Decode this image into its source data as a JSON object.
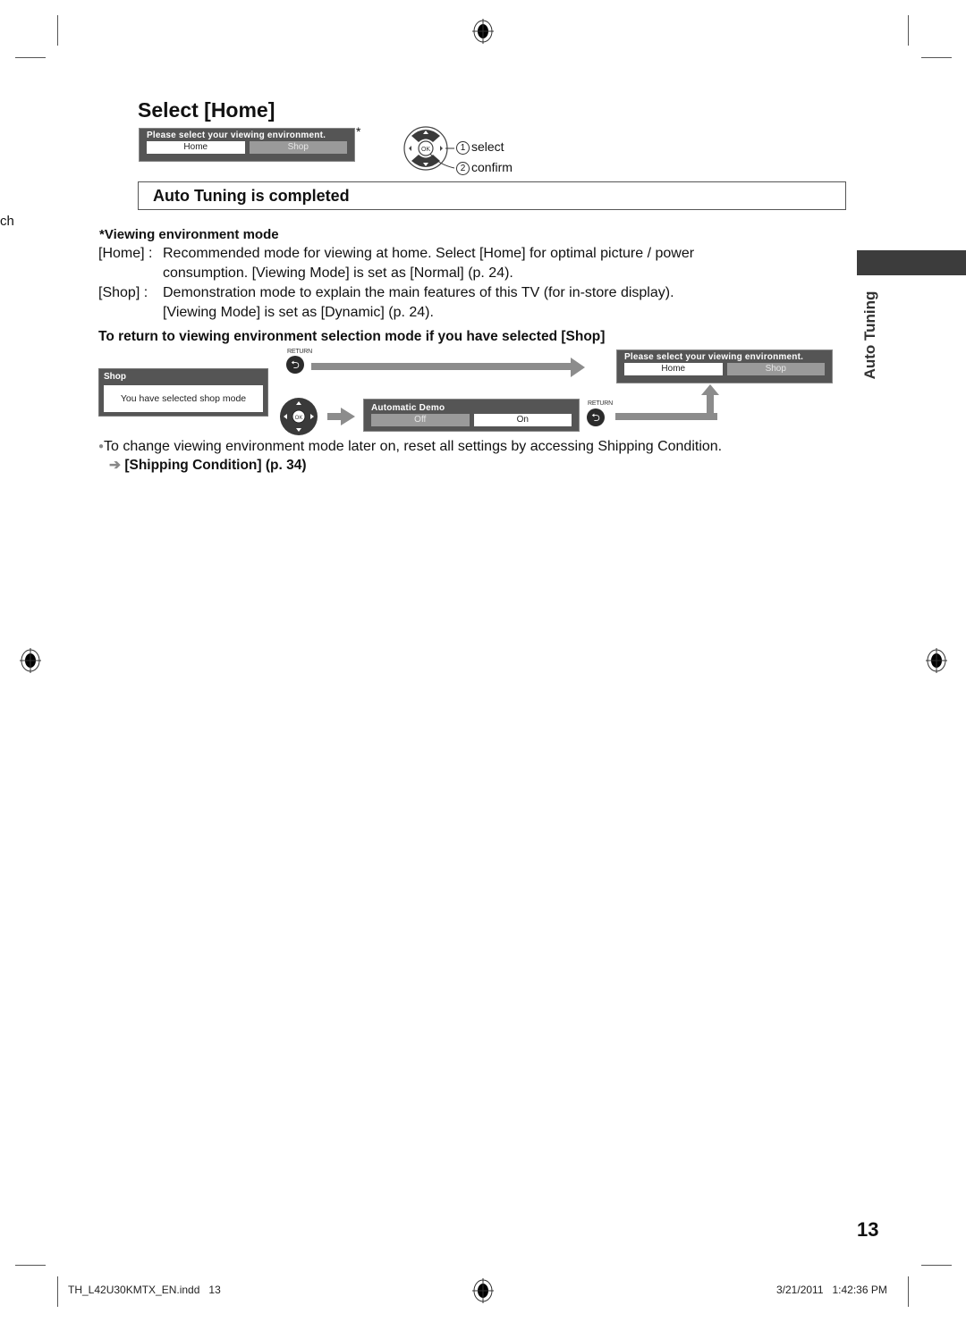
{
  "page": {
    "number": "13",
    "left_edge_fragment": "ch",
    "footer_file": "TH_L42U30KMTX_EN.indd   13",
    "footer_timestamp": "3/21/2011   1:42:36 PM"
  },
  "section_tab": {
    "label": "Auto Tuning"
  },
  "select_home": {
    "title": "Select [Home]",
    "menu": {
      "title": "Please select your viewing environment.",
      "options": [
        "Home",
        "Shop"
      ],
      "selected": "Home"
    },
    "footnote_mark": "*",
    "remote_steps": [
      {
        "num": "1",
        "label": "select"
      },
      {
        "num": "2",
        "label": "confirm"
      }
    ],
    "ok_label": "OK"
  },
  "completed_box": {
    "text": "Auto Tuning is completed"
  },
  "viewing_mode": {
    "heading": "*Viewing environment mode",
    "entries": [
      {
        "term": "[Home] :",
        "line1": "Recommended mode for viewing at home. Select [Home] for optimal picture / power",
        "line2": "consumption. [Viewing Mode] is set as [Normal] (p. 24)."
      },
      {
        "term": "[Shop]  :",
        "line1": "Demonstration mode to explain the main features of this TV (for in-store display).",
        "line2": "[Viewing Mode] is set as [Dynamic] (p. 24)."
      }
    ]
  },
  "return_section": {
    "heading": "To return to viewing environment selection mode if you have selected [Shop]",
    "shop_box": {
      "title": "Shop",
      "message": "You have selected shop mode"
    },
    "return_label": "RETURN",
    "auto_demo_box": {
      "title": "Automatic Demo",
      "options": [
        "Off",
        "On"
      ],
      "selected": "On"
    },
    "env_box": {
      "title": "Please select your viewing environment.",
      "options": [
        "Home",
        "Shop"
      ],
      "selected": "Home"
    }
  },
  "note": {
    "bullet": "To change viewing environment mode later on, reset all settings by accessing Shipping Condition.",
    "link": "[Shipping Condition] (p. 34)"
  }
}
